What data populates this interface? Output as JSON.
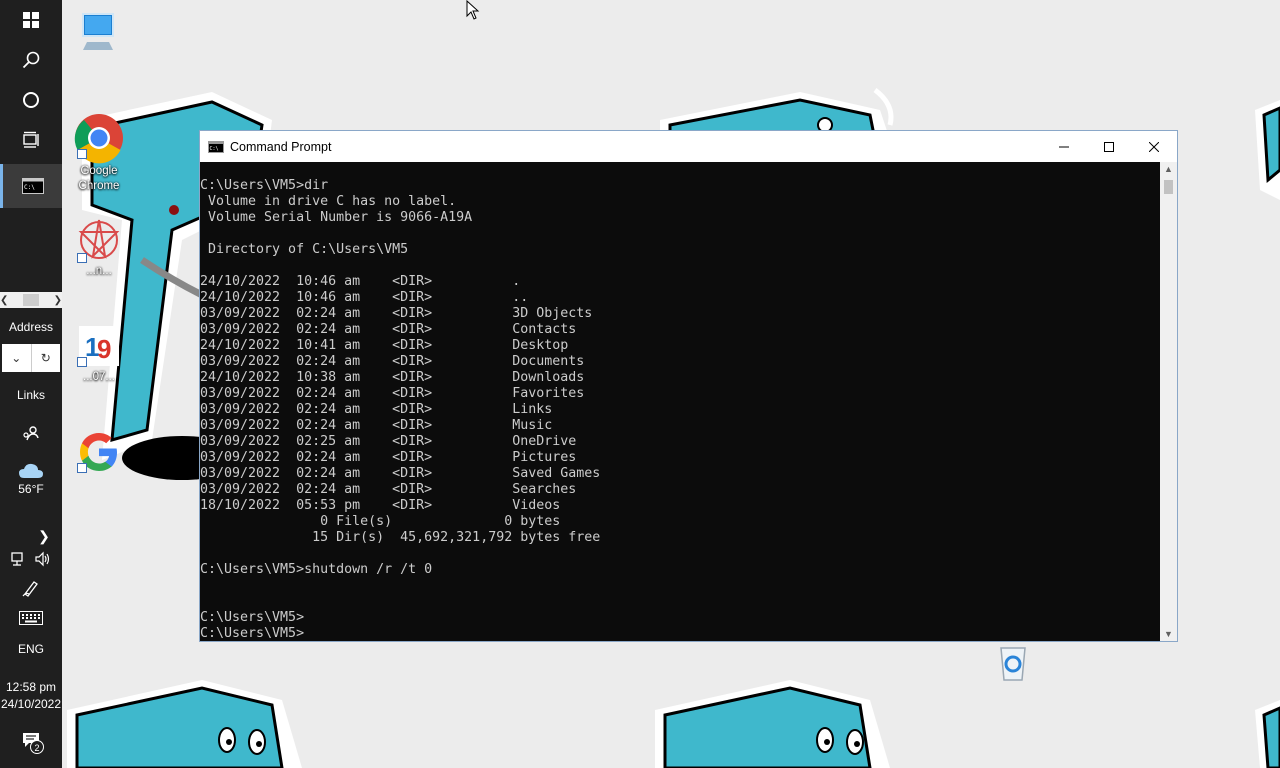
{
  "taskbar": {
    "address_label": "Address",
    "links_label": "Links",
    "weather_temp": "56°F",
    "language": "ENG",
    "time": "12:58 pm",
    "date": "24/10/2022",
    "notification_count": "2",
    "icons": [
      "windows-start-icon",
      "search-icon",
      "cortana-icon",
      "task-view-icon",
      "command-prompt-icon"
    ]
  },
  "desktop": {
    "icons": [
      {
        "name": "this-pc",
        "label": ""
      },
      {
        "name": "google-chrome",
        "label": "Google Chrome"
      },
      {
        "name": "app-shortcut-red",
        "label": "...n..."
      },
      {
        "name": "app-shortcut-19",
        "label": "...07..."
      },
      {
        "name": "google",
        "label": ""
      },
      {
        "name": "recycle-bin",
        "label": ""
      }
    ]
  },
  "cmd": {
    "title": "Command Prompt",
    "output": "C:\\Users\\VM5>dir\n Volume in drive C has no label.\n Volume Serial Number is 9066-A19A\n\n Directory of C:\\Users\\VM5\n\n24/10/2022  10:46 am    <DIR>          .\n24/10/2022  10:46 am    <DIR>          ..\n03/09/2022  02:24 am    <DIR>          3D Objects\n03/09/2022  02:24 am    <DIR>          Contacts\n24/10/2022  10:41 am    <DIR>          Desktop\n03/09/2022  02:24 am    <DIR>          Documents\n24/10/2022  10:38 am    <DIR>          Downloads\n03/09/2022  02:24 am    <DIR>          Favorites\n03/09/2022  02:24 am    <DIR>          Links\n03/09/2022  02:24 am    <DIR>          Music\n03/09/2022  02:25 am    <DIR>          OneDrive\n03/09/2022  02:24 am    <DIR>          Pictures\n03/09/2022  02:24 am    <DIR>          Saved Games\n03/09/2022  02:24 am    <DIR>          Searches\n18/10/2022  05:53 pm    <DIR>          Videos\n               0 File(s)              0 bytes\n              15 Dir(s)  45,692,321,792 bytes free\n\nC:\\Users\\VM5>shutdown /r /t 0\n\n\nC:\\Users\\VM5>\nC:\\Users\\VM5>"
  },
  "colors": {
    "taskbar_bg": "#1f1f1f",
    "console_bg": "#0c0c0c",
    "console_text": "#cccccc",
    "accent": "#7ab4ea",
    "mascot_teal": "#3fb8cc"
  }
}
